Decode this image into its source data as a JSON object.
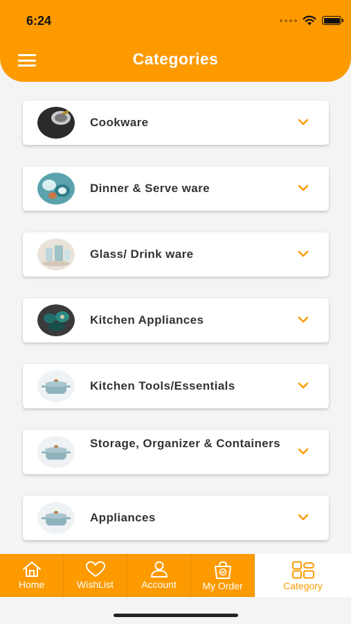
{
  "status_bar": {
    "time": "6:24"
  },
  "header": {
    "title": "Categories"
  },
  "categories": [
    {
      "label": "Cookware",
      "thumb": "cookware"
    },
    {
      "label": "Dinner & Serve ware",
      "thumb": "dinnerware"
    },
    {
      "label": "Glass/ Drink ware",
      "thumb": "glassware"
    },
    {
      "label": "Kitchen Appliances",
      "thumb": "appliances-set"
    },
    {
      "label": "Kitchen Tools/Essentials",
      "thumb": "pot"
    },
    {
      "label": "Storage, Organizer & Containers",
      "thumb": "pot"
    },
    {
      "label": "Appliances",
      "thumb": "pot"
    }
  ],
  "tabbar": {
    "home": "Home",
    "wishlist": "WishList",
    "account": "Account",
    "my_order": "My Order",
    "category": "Category",
    "active": "Category"
  },
  "colors": {
    "accent": "#fc9a00",
    "background": "#f4f4f4",
    "text": "#333333"
  },
  "icons": [
    "menu-icon",
    "chevron-down-icon",
    "home-icon",
    "heart-icon",
    "user-icon",
    "shopping-bag-icon",
    "category-grid-icon",
    "wifi-icon",
    "battery-icon"
  ]
}
